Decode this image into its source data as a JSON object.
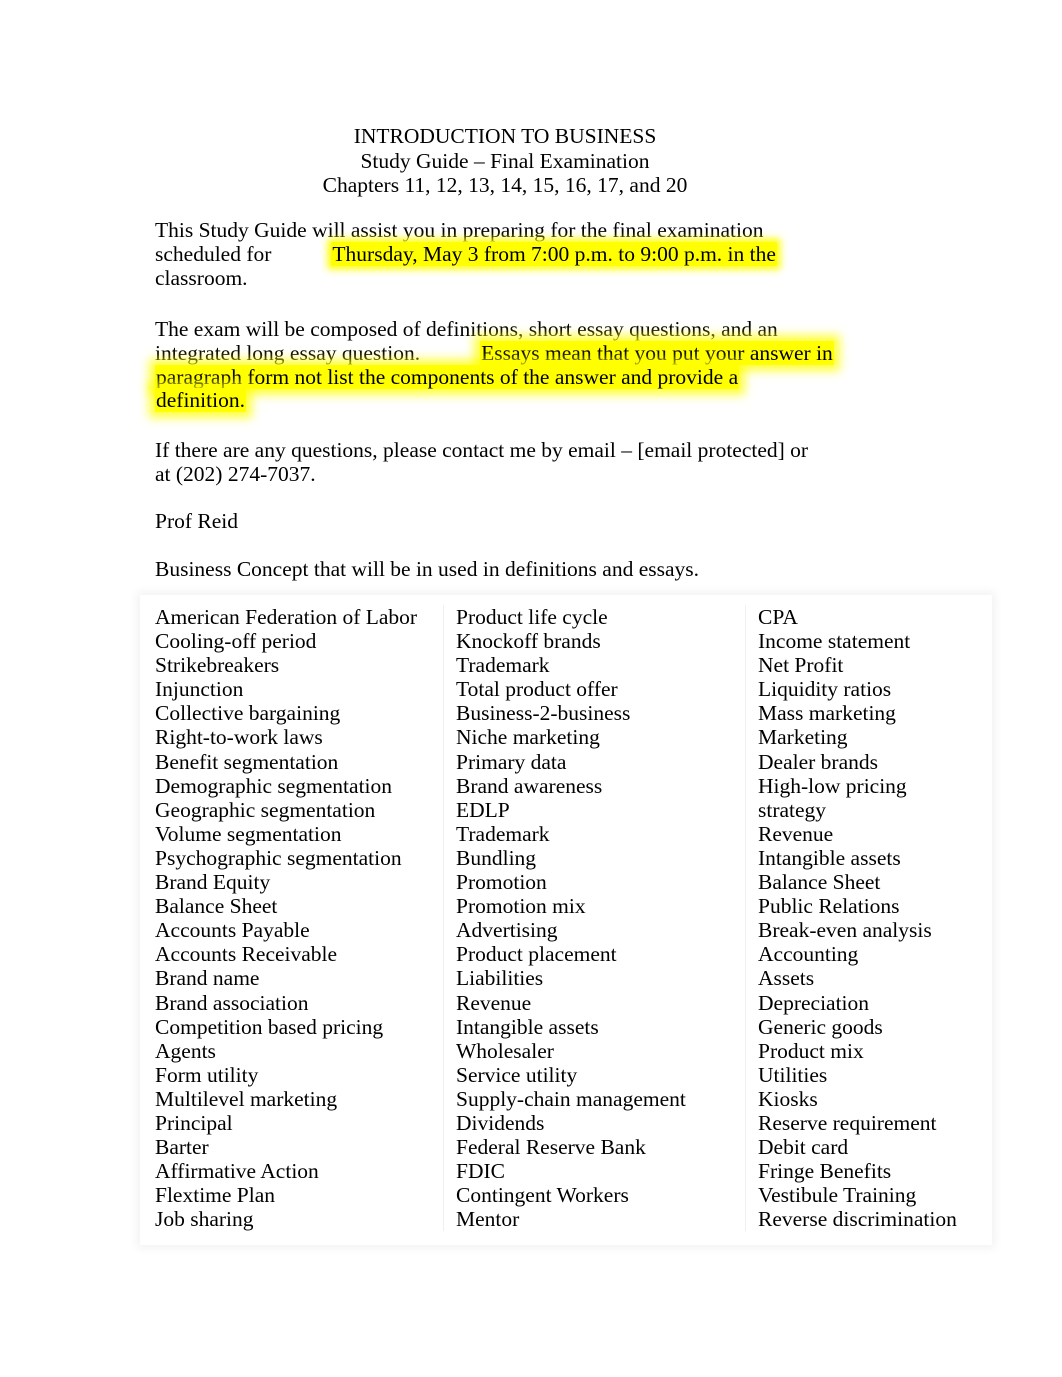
{
  "document": {
    "heading": {
      "line1": "INTRODUCTION TO BUSINESS",
      "line2": "Study Guide – Final Examination",
      "line3": "Chapters 11, 12, 13, 14, 15, 16, 17, and 20"
    },
    "intro_paragraph": {
      "line1": "This Study Guide will assist you in preparing for the final examination",
      "line2_prefix": "scheduled for",
      "line2_highlight": "Thursday, May 3 from 7:00 p.m. to 9:00 p.m. in the",
      "line3": "classroom."
    },
    "exam_paragraph": {
      "line1": "The exam will be composed of definitions, short essay questions, and an",
      "line2_prefix": "integrated long essay question.",
      "line2_highlight": "Essays mean that you put your answer in",
      "line3_highlight": "paragraph form not list the components of the answer and provide a",
      "line4_highlight": "definition."
    },
    "contact_paragraph": {
      "line1": "If there are any questions, please contact me by email – [email protected] or",
      "line2": "at (202) 274-7037."
    },
    "signature": "Prof Reid",
    "concepts_intro": "Business Concept that will be in used in definitions and essays.",
    "highlight_color": "#ffff00"
  },
  "concept_table": {
    "columns": [
      {
        "name": "column-1",
        "items": [
          "American Federation of Labor",
          "Cooling-off period",
          "Strikebreakers",
          "Injunction",
          "Collective bargaining",
          "Right-to-work laws",
          "Benefit segmentation",
          "Demographic segmentation",
          "Geographic segmentation",
          "Volume segmentation",
          "Psychographic segmentation",
          "Brand Equity",
          "Balance Sheet",
          "Accounts Payable",
          "Accounts Receivable",
          "Brand name",
          "Brand association",
          "Competition based pricing",
          "Agents",
          "Form utility",
          "Multilevel marketing",
          "Principal",
          "Barter",
          "Affirmative Action",
          "Flextime Plan",
          "Job sharing"
        ]
      },
      {
        "name": "column-2",
        "items": [
          "Product life cycle",
          "Knockoff brands",
          "Trademark",
          "Total product offer",
          "Business-2-business",
          "Niche marketing",
          "Primary data",
          "Brand awareness",
          "EDLP",
          "Trademark",
          "Bundling",
          "Promotion",
          "Promotion mix",
          "Advertising",
          "Product placement",
          "Liabilities",
          "Revenue",
          "Intangible assets",
          "Wholesaler",
          "Service utility",
          "Supply-chain management",
          "Dividends",
          "Federal Reserve Bank",
          "FDIC",
          "Contingent Workers",
          "Mentor"
        ]
      },
      {
        "name": "column-3",
        "items": [
          "CPA",
          "Income statement",
          "Net Profit",
          "Liquidity ratios",
          "Mass marketing",
          "Marketing",
          "Dealer brands",
          "High-low pricing",
          "strategy",
          "Revenue",
          "Intangible assets",
          "Balance Sheet",
          "Public Relations",
          "Break-even analysis",
          "Accounting",
          "Assets",
          "Depreciation",
          "Generic goods",
          "Product mix",
          "Utilities",
          "Kiosks",
          "Reserve requirement",
          "Debit card",
          "Fringe Benefits",
          "Vestibule Training",
          "Reverse discrimination"
        ]
      }
    ]
  }
}
